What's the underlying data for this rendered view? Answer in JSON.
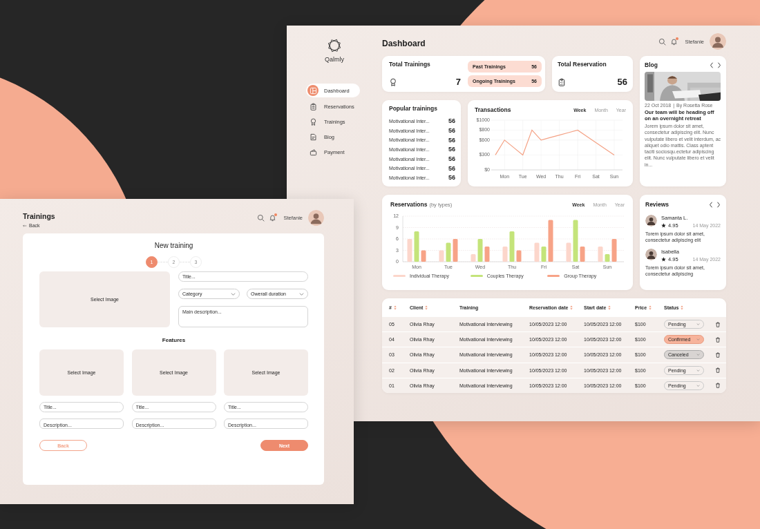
{
  "dashboard": {
    "brand": "Qalmly",
    "nav": [
      {
        "label": "Dashboard",
        "selected": true
      },
      {
        "label": "Reservations",
        "selected": false
      },
      {
        "label": "Trainings",
        "selected": false
      },
      {
        "label": "Blog",
        "selected": false
      },
      {
        "label": "Payment",
        "selected": false
      }
    ],
    "title": "Dashboard",
    "user": "Stefanie",
    "has_notification": true,
    "total_trainings": {
      "title": "Total Trainings",
      "value": "7",
      "breakdown": [
        {
          "label": "Past Trainings",
          "value": "56"
        },
        {
          "label": "Ongoing Trainings",
          "value": "56"
        }
      ]
    },
    "total_reservation": {
      "title": "Total Reservation",
      "value": "56"
    },
    "blog": {
      "title": "Blog",
      "date": "22 Oct 2018",
      "separator": "|",
      "author": "By Rosetta Rose",
      "headline": "Our team will be heading off on an overnight retreat",
      "excerpt": "Jorem ipsum dolor sit amet, consectetur adipiscing elit. Nunc vulputate libero et velit interdum, ac aliquet odio mattis. Class aptent taciti sociosqu.ectetur adipiscing elit. Nunc vulputate libero et velit in..."
    },
    "popular": {
      "title": "Popular trainings",
      "items": [
        {
          "name": "Motivational Inter...",
          "count": "56"
        },
        {
          "name": "Motivational Inter...",
          "count": "56"
        },
        {
          "name": "Motivational Inter...",
          "count": "56"
        },
        {
          "name": "Motivational Inter...",
          "count": "56"
        },
        {
          "name": "Motivational Inter...",
          "count": "56"
        },
        {
          "name": "Motivational Inter...",
          "count": "56"
        },
        {
          "name": "Motivational Inter...",
          "count": "56"
        }
      ]
    },
    "transactions": {
      "title": "Transactions",
      "periods": [
        {
          "label": "Week",
          "selected": true
        },
        {
          "label": "Month",
          "selected": false
        },
        {
          "label": "Year",
          "selected": false
        }
      ],
      "chart_data": {
        "type": "line",
        "grid": true,
        "categories": [
          null,
          "Mon",
          null,
          "Tue",
          null,
          "Wed",
          null,
          "Thu",
          null,
          "Fri",
          null,
          "Sat",
          null,
          "Sun"
        ],
        "ylim": [
          0,
          1000
        ],
        "yticks": [
          {
            "value": 0,
            "label": "$0"
          },
          {
            "value": 300,
            "label": "$300"
          },
          {
            "value": 600,
            "label": "$600"
          },
          {
            "value": 800,
            "label": "$800"
          },
          {
            "value": 1000,
            "label": "$1000"
          }
        ],
        "series": [
          {
            "color": "#f4a184",
            "values": [
              300,
              600,
              450,
              300,
              800,
              600,
              650,
              700,
              750,
              800,
              675,
              550,
              425,
              300
            ]
          }
        ]
      }
    },
    "reservations": {
      "title": "Reservations",
      "subtitle": "(by types)",
      "periods": [
        {
          "label": "Week",
          "selected": true
        },
        {
          "label": "Month",
          "selected": false
        },
        {
          "label": "Year",
          "selected": false
        }
      ],
      "chart_data": {
        "type": "bar",
        "grid": true,
        "legend": true,
        "categories": [
          "Mon",
          "Tue",
          "Wed",
          "Thu",
          "Fri",
          "Sat",
          "Sun"
        ],
        "ylim": [
          0,
          12
        ],
        "yticks": [
          0,
          3,
          6,
          9,
          12
        ],
        "series": [
          {
            "name": "Individual Therapy",
            "color": "#fcd6cb",
            "values": [
              6,
              3,
              2,
              4,
              5,
              5,
              4
            ]
          },
          {
            "name": "Couples Therapy",
            "color": "#c4e47a",
            "values": [
              8,
              5,
              6,
              8,
              4,
              11,
              2
            ]
          },
          {
            "name": "Group Therapy",
            "color": "#f7a387",
            "values": [
              3,
              6,
              4,
              3,
              11,
              4,
              6
            ]
          }
        ]
      }
    },
    "reviews": {
      "title": "Reviews",
      "items": [
        {
          "name": "Samanta L.",
          "rating": "4.95",
          "date": "14 May 2022",
          "text": "Torem ipsum dolor sit amet, consectetur adipiscing elit"
        },
        {
          "name": "Isabella",
          "rating": "4.95",
          "date": "14 May 2022",
          "text": "Torem ipsum dolor sit amet, consectetur adipiscing"
        }
      ]
    },
    "table": {
      "columns": [
        {
          "label": "#",
          "sortable": true
        },
        {
          "label": "Client",
          "sortable": true
        },
        {
          "label": "Training",
          "sortable": false
        },
        {
          "label": "Reservation date",
          "sortable": true
        },
        {
          "label": "Start date",
          "sortable": true
        },
        {
          "label": "Price",
          "sortable": true
        },
        {
          "label": "Status",
          "sortable": true
        }
      ],
      "rows": [
        {
          "cells": [
            "05",
            "Olivia Rhay",
            "Motivational Interviewing",
            "10/05/2023 12:00",
            "10/05/2023 12:00",
            "$100"
          ],
          "status": {
            "label": "Pending",
            "kind": "pending"
          }
        },
        {
          "cells": [
            "04",
            "Olivia Rhay",
            "Motivational Interviewing",
            "10/05/2023 12:00",
            "10/05/2023 12:00",
            "$100"
          ],
          "status": {
            "label": "Confirmed",
            "kind": "confirmed"
          }
        },
        {
          "cells": [
            "03",
            "Olivia Rhay",
            "Motivational Interviewing",
            "10/05/2023 12:00",
            "10/05/2023 12:00",
            "$100"
          ],
          "status": {
            "label": "Canceled",
            "kind": "canceled"
          }
        },
        {
          "cells": [
            "02",
            "Olivia Rhay",
            "Motivational Interviewing",
            "10/05/2023 12:00",
            "10/05/2023 12:00",
            "$100"
          ],
          "status": {
            "label": "Pending",
            "kind": "pending"
          }
        },
        {
          "cells": [
            "01",
            "Olivia Rhay",
            "Motivational Interviewing",
            "10/05/2023 12:00",
            "10/05/2023 12:00",
            "$100"
          ],
          "status": {
            "label": "Pending",
            "kind": "pending"
          }
        }
      ]
    }
  },
  "trainings": {
    "title": "Trainings",
    "back": "Back",
    "user": "Stefanie",
    "has_notification": true,
    "form": {
      "title": "New training",
      "steps": [
        {
          "label": "1",
          "selected": true
        },
        {
          "label": "2",
          "selected": false
        },
        {
          "label": "3",
          "selected": false
        }
      ],
      "image_label": "Select Image",
      "title_placeholder": "Title...",
      "category": "Category",
      "duration": "Owerall duration",
      "description_placeholder": "Main description...",
      "features_title": "Features",
      "features": [
        {
          "image_label": "Select Image",
          "title_placeholder": "Title...",
          "description_placeholder": "Description..."
        },
        {
          "image_label": "Select Image",
          "title_placeholder": "Title...",
          "description_placeholder": "Description..."
        },
        {
          "image_label": "Select Image",
          "title_placeholder": "Title...",
          "description_placeholder": "Description..."
        }
      ],
      "back_button": "Back",
      "next_button": "Next"
    }
  }
}
